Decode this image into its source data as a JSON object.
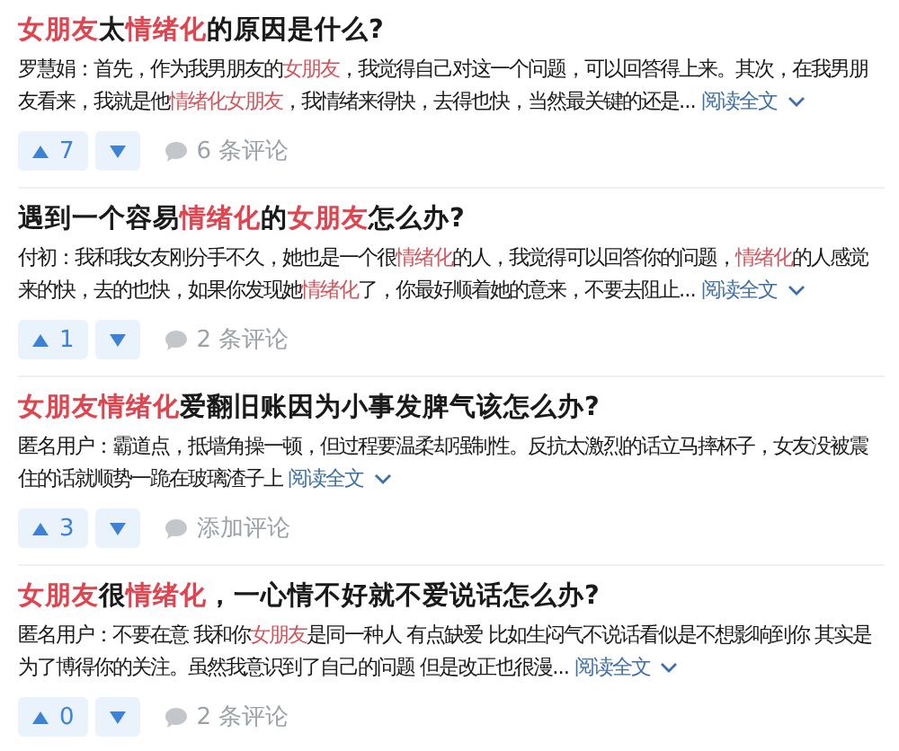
{
  "answers": [
    {
      "title": [
        {
          "text": "女朋友",
          "highlight": true
        },
        {
          "text": "太",
          "highlight": false
        },
        {
          "text": "情绪化",
          "highlight": true
        },
        {
          "text": "的原因是什么?",
          "highlight": false
        }
      ],
      "excerpt": [
        {
          "text": "罗慧娟：首先，作为我男朋友的",
          "highlight": false
        },
        {
          "text": "女朋友",
          "highlight": true
        },
        {
          "text": "，我觉得自己对这一个问题，可以回答得上来。其次，在我男朋友看来，我就是他",
          "highlight": false
        },
        {
          "text": "情绪化女朋友",
          "highlight": true
        },
        {
          "text": "，我情绪来得快，去得也快，当然最关键的还是...",
          "highlight": false
        }
      ],
      "read_more": "阅读全文",
      "upvotes": "7",
      "comments": "6 条评论"
    },
    {
      "title": [
        {
          "text": "遇到一个容易",
          "highlight": false
        },
        {
          "text": "情绪化",
          "highlight": true
        },
        {
          "text": "的",
          "highlight": false
        },
        {
          "text": "女朋友",
          "highlight": true
        },
        {
          "text": "怎么办?",
          "highlight": false
        }
      ],
      "excerpt": [
        {
          "text": "付初：我和我女友刚分手不久，她也是一个很",
          "highlight": false
        },
        {
          "text": "情绪化",
          "highlight": true
        },
        {
          "text": "的人，我觉得可以回答你的问题，",
          "highlight": false
        },
        {
          "text": "情绪化",
          "highlight": true
        },
        {
          "text": "的人感觉来的快，去的也快，如果你发现她",
          "highlight": false
        },
        {
          "text": "情绪化",
          "highlight": true
        },
        {
          "text": "了，你最好顺着她的意来，不要去阻止...",
          "highlight": false
        }
      ],
      "read_more": "阅读全文",
      "upvotes": "1",
      "comments": "2 条评论"
    },
    {
      "title": [
        {
          "text": "女朋友情绪化",
          "highlight": true
        },
        {
          "text": "爱翻旧账因为小事发脾气该怎么办?",
          "highlight": false
        }
      ],
      "excerpt": [
        {
          "text": "匿名用户：霸道点，抵墙角操一顿，但过程要温柔却强制性。反抗太激烈的话立马摔杯子，女友没被震住的话就顺势一跪在玻璃渣子上",
          "highlight": false
        }
      ],
      "read_more": "阅读全文",
      "upvotes": "3",
      "comments": "添加评论"
    },
    {
      "title": [
        {
          "text": "女朋友",
          "highlight": true
        },
        {
          "text": "很",
          "highlight": false
        },
        {
          "text": "情绪化",
          "highlight": true
        },
        {
          "text": "，一心情不好就不爱说话怎么办?",
          "highlight": false
        }
      ],
      "excerpt": [
        {
          "text": "匿名用户：不要在意 我和你",
          "highlight": false
        },
        {
          "text": "女朋友",
          "highlight": true
        },
        {
          "text": "是同一种人 有点缺爱 比如生闷气不说话看似是不想影响到你 其实是为了博得你的关注。虽然我意识到了自己的问题 但是改正也很漫...",
          "highlight": false
        }
      ],
      "read_more": "阅读全文",
      "upvotes": "0",
      "comments": "2 条评论"
    }
  ]
}
